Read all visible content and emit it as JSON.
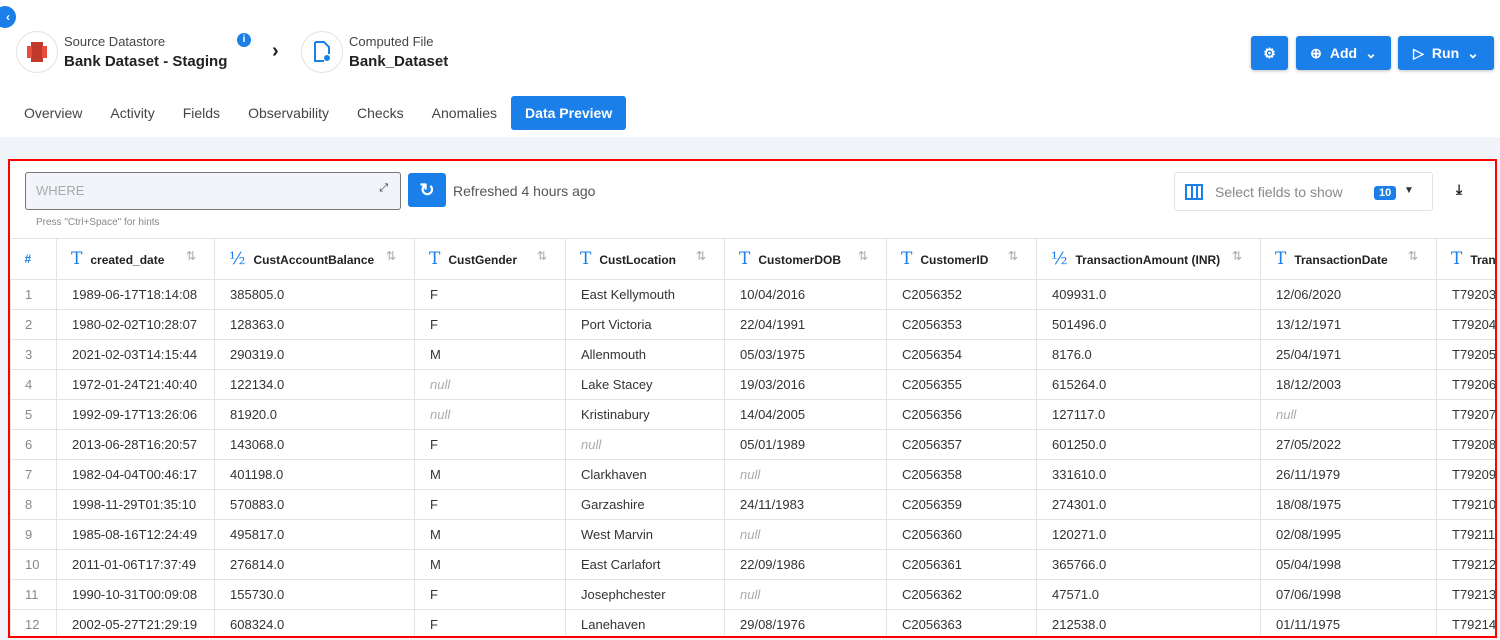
{
  "header": {
    "source_label": "Source Datastore",
    "source_name": "Bank Dataset - Staging",
    "target_label": "Computed File",
    "target_name": "Bank_Dataset",
    "add_label": "Add",
    "run_label": "Run"
  },
  "tabs": [
    "Overview",
    "Activity",
    "Fields",
    "Observability",
    "Checks",
    "Anomalies",
    "Data Preview"
  ],
  "active_tab": "Data Preview",
  "toolbar": {
    "where_placeholder": "WHERE",
    "hint": "Press \"Ctrl+Space\" for hints",
    "refreshed": "Refreshed 4 hours ago",
    "fields_placeholder": "Select fields to show",
    "fields_count": "10"
  },
  "table": {
    "columns": [
      {
        "name": "created_date",
        "type": "T"
      },
      {
        "name": "CustAccountBalance",
        "type": "½"
      },
      {
        "name": "CustGender",
        "type": "T"
      },
      {
        "name": "CustLocation",
        "type": "T"
      },
      {
        "name": "CustomerDOB",
        "type": "T"
      },
      {
        "name": "CustomerID",
        "type": "T"
      },
      {
        "name": "TransactionAmount (INR)",
        "type": "½"
      },
      {
        "name": "TransactionDate",
        "type": "T"
      },
      {
        "name": "Tran",
        "type": "T"
      }
    ],
    "rows": [
      [
        "1",
        "1989-06-17T18:14:08",
        "385805.0",
        "F",
        "East Kellymouth",
        "10/04/2016",
        "C2056352",
        "409931.0",
        "12/06/2020",
        "T79203"
      ],
      [
        "2",
        "1980-02-02T10:28:07",
        "128363.0",
        "F",
        "Port Victoria",
        "22/04/1991",
        "C2056353",
        "501496.0",
        "13/12/1971",
        "T79204"
      ],
      [
        "3",
        "2021-02-03T14:15:44",
        "290319.0",
        "M",
        "Allenmouth",
        "05/03/1975",
        "C2056354",
        "8176.0",
        "25/04/1971",
        "T79205"
      ],
      [
        "4",
        "1972-01-24T21:40:40",
        "122134.0",
        "null",
        "Lake Stacey",
        "19/03/2016",
        "C2056355",
        "615264.0",
        "18/12/2003",
        "T79206"
      ],
      [
        "5",
        "1992-09-17T13:26:06",
        "81920.0",
        "null",
        "Kristinabury",
        "14/04/2005",
        "C2056356",
        "127117.0",
        "null",
        "T79207"
      ],
      [
        "6",
        "2013-06-28T16:20:57",
        "143068.0",
        "F",
        "null",
        "05/01/1989",
        "C2056357",
        "601250.0",
        "27/05/2022",
        "T79208"
      ],
      [
        "7",
        "1982-04-04T00:46:17",
        "401198.0",
        "M",
        "Clarkhaven",
        "null",
        "C2056358",
        "331610.0",
        "26/11/1979",
        "T79209"
      ],
      [
        "8",
        "1998-11-29T01:35:10",
        "570883.0",
        "F",
        "Garzashire",
        "24/11/1983",
        "C2056359",
        "274301.0",
        "18/08/1975",
        "T79210"
      ],
      [
        "9",
        "1985-08-16T12:24:49",
        "495817.0",
        "M",
        "West Marvin",
        "null",
        "C2056360",
        "120271.0",
        "02/08/1995",
        "T79211"
      ],
      [
        "10",
        "2011-01-06T17:37:49",
        "276814.0",
        "M",
        "East Carlafort",
        "22/09/1986",
        "C2056361",
        "365766.0",
        "05/04/1998",
        "T79212"
      ],
      [
        "11",
        "1990-10-31T00:09:08",
        "155730.0",
        "F",
        "Josephchester",
        "null",
        "C2056362",
        "47571.0",
        "07/06/1998",
        "T79213"
      ],
      [
        "12",
        "2002-05-27T21:29:19",
        "608324.0",
        "F",
        "Lanehaven",
        "29/08/1976",
        "C2056363",
        "212538.0",
        "01/11/1975",
        "T79214"
      ]
    ]
  }
}
